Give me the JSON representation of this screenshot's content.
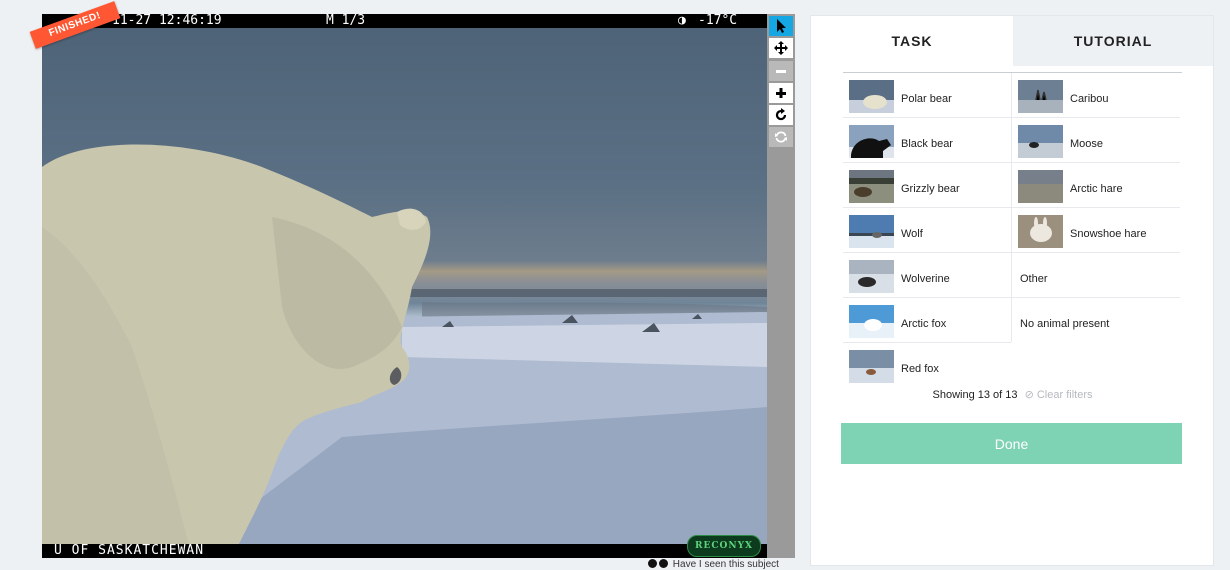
{
  "camera": {
    "timestamp": "11-27 12:46:19",
    "sequence": "M 1/3",
    "temperature": "-17°C",
    "caption": "U OF SASKATCHEWAN",
    "brand": "RECONYX"
  },
  "badge": {
    "label": "FINISHED!"
  },
  "tools": [
    {
      "name": "pointer",
      "icon": "arrow-pointer-icon",
      "active": true
    },
    {
      "name": "pan",
      "icon": "move-icon"
    },
    {
      "name": "zoom-out",
      "icon": "minus-icon",
      "disabled": true
    },
    {
      "name": "zoom-in",
      "icon": "plus-icon"
    },
    {
      "name": "rotate",
      "icon": "rotate-icon"
    },
    {
      "name": "reset",
      "icon": "refresh-icon",
      "disabled": true
    }
  ],
  "below_image_text": "Have I seen this subject",
  "tabs": {
    "task": "TASK",
    "tutorial": "TUTORIAL"
  },
  "choices_left": [
    {
      "label": "Polar bear",
      "thumb": "polar-bear"
    },
    {
      "label": "Black bear",
      "thumb": "black-bear"
    },
    {
      "label": "Grizzly bear",
      "thumb": "grizzly-bear"
    },
    {
      "label": "Wolf",
      "thumb": "wolf"
    },
    {
      "label": "Wolverine",
      "thumb": "wolverine"
    },
    {
      "label": "Arctic fox",
      "thumb": "arctic-fox"
    },
    {
      "label": "Red fox",
      "thumb": "red-fox"
    }
  ],
  "choices_right": [
    {
      "label": "Caribou",
      "thumb": "caribou"
    },
    {
      "label": "Moose",
      "thumb": "moose"
    },
    {
      "label": "Arctic hare",
      "thumb": "arctic-hare"
    },
    {
      "label": "Snowshoe hare",
      "thumb": "snowshoe-hare"
    },
    {
      "label": "Other"
    },
    {
      "label": "No animal present"
    }
  ],
  "filter": {
    "showing": "Showing 13 of 13",
    "clear": "Clear filters"
  },
  "done_label": "Done",
  "colors": {
    "accent": "#14a7e4",
    "done": "#7dd3b3",
    "badge": "#ff5733"
  }
}
